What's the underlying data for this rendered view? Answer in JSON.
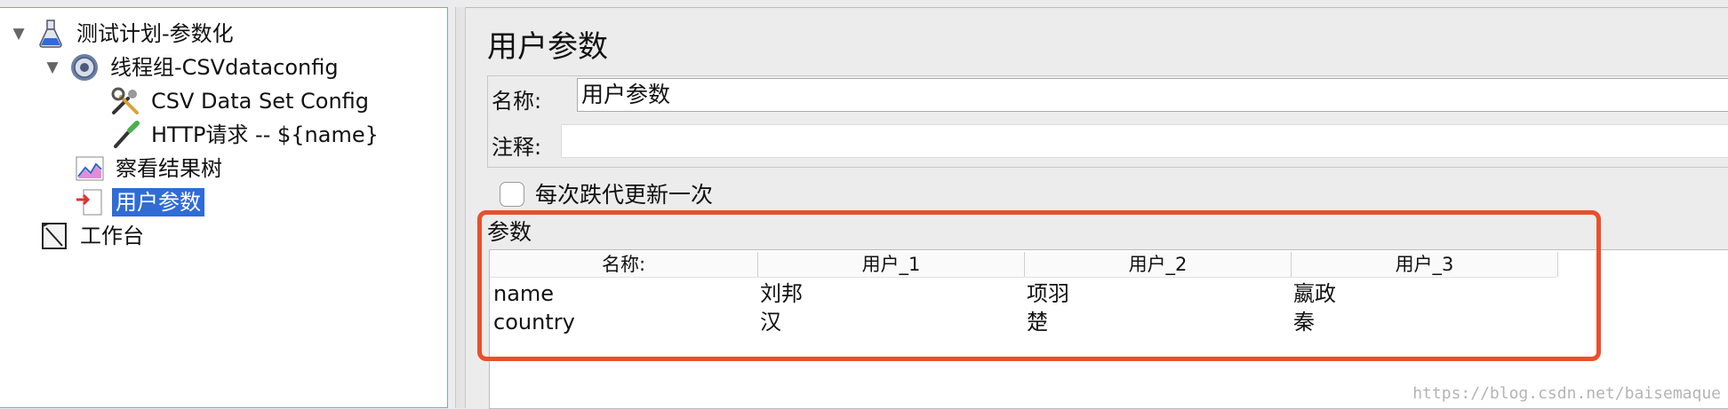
{
  "tree": {
    "nodes": [
      {
        "label": "测试计划-参数化",
        "icon": "flask-icon"
      },
      {
        "label": "线程组-CSVdataconfig",
        "icon": "gear-icon"
      },
      {
        "label": "CSV Data Set Config",
        "icon": "tools-icon"
      },
      {
        "label": "HTTP请求 -- ${name}",
        "icon": "pipette-icon"
      },
      {
        "label": "察看结果树",
        "icon": "chart-icon"
      },
      {
        "label": "用户参数",
        "icon": "user-params-icon"
      },
      {
        "label": "工作台",
        "icon": "workbench-icon"
      }
    ]
  },
  "panel": {
    "title": "用户参数",
    "name_label": "名称:",
    "name_value": "用户参数",
    "comment_label": "注释:",
    "comment_value": "",
    "checkbox_label": "每次跌代更新一次",
    "params_title": "参数"
  },
  "table": {
    "headers": [
      "名称:",
      "用户_1",
      "用户_2",
      "用户_3"
    ],
    "rows": [
      [
        "name",
        "刘邦",
        "项羽",
        "嬴政"
      ],
      [
        "country",
        "汉",
        "楚",
        "秦"
      ]
    ]
  },
  "watermark": "https://blog.csdn.net/baisemaque",
  "colors": {
    "selection": "#2f6cd6",
    "highlight": "#e9502c"
  }
}
